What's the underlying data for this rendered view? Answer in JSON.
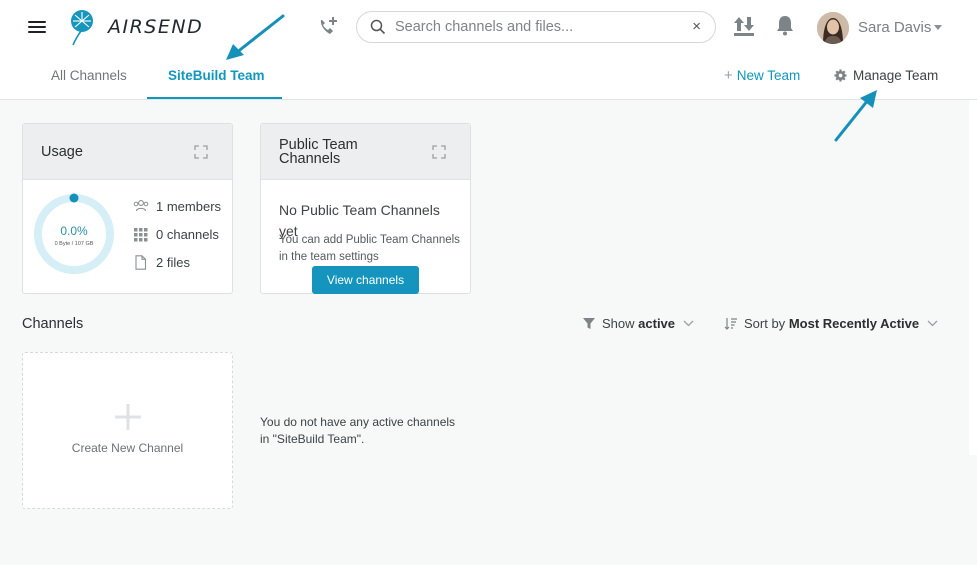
{
  "header": {
    "brand": "AIRSEND",
    "search": {
      "placeholder": "Search channels and files...",
      "value": "",
      "clear_label": "×"
    },
    "user": {
      "name": "Sara Davis"
    }
  },
  "tabs": {
    "all": "All Channels",
    "team": "SiteBuild Team"
  },
  "actions": {
    "new_team": "New Team",
    "new_team_plus": "+",
    "manage_team": "Manage Team"
  },
  "usage": {
    "title": "Usage",
    "percent_text": "0.0%",
    "percent_value": 0.0,
    "storage_text": "0 Byte / 107 GB",
    "members": "1 members",
    "channels": "0 channels",
    "files": "2 files"
  },
  "public_channels": {
    "title_line1": "Public Team",
    "title_line2": "Channels",
    "empty_title": "No Public Team Channels yet",
    "empty_text": "You can add Public Team Channels in the team settings",
    "button": "View channels"
  },
  "channels": {
    "title": "Channels",
    "filter_prefix": "Show",
    "filter_value": "active",
    "sort_prefix": "Sort by",
    "sort_value": "Most Recently Active",
    "create_label": "Create New Channel",
    "empty_line1": "You do not have any active channels",
    "empty_line2": "in \"SiteBuild Team\"."
  },
  "colors": {
    "accent": "#0f97bd",
    "ring_track": "#d6eef5",
    "annotation_arrow": "#1590b8"
  },
  "icons": [
    "menu-icon",
    "dandelion-logo-icon",
    "add-call-icon",
    "search-icon",
    "close-icon",
    "upload-download-icon",
    "bell-icon",
    "gear-icon",
    "expand-icon",
    "users-icon",
    "grid-icon",
    "file-icon",
    "filter-icon",
    "sort-icon",
    "chevron-down-icon",
    "plus-icon"
  ]
}
